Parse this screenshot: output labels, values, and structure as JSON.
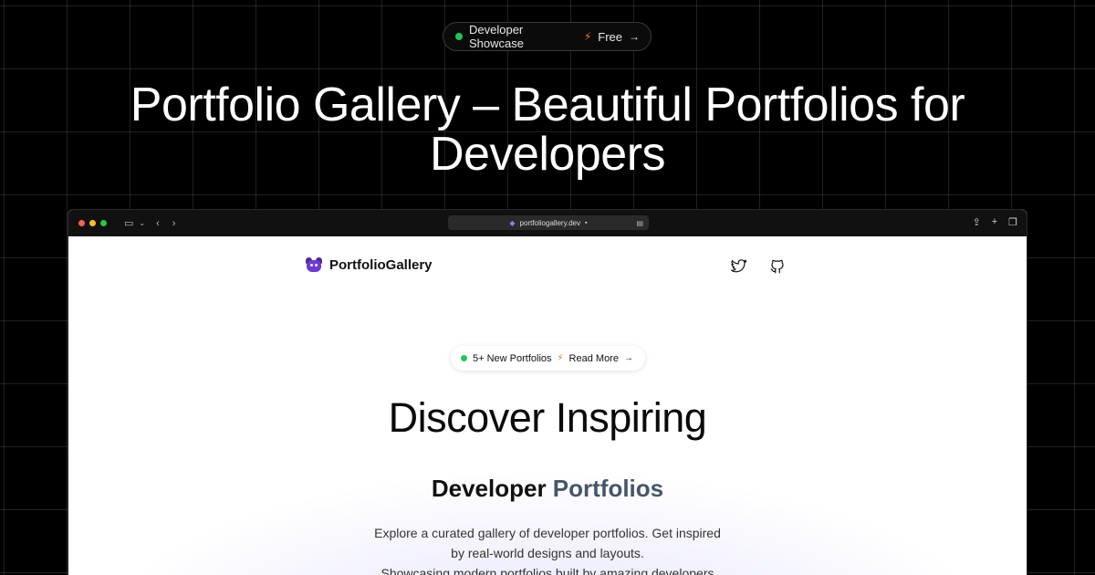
{
  "top_badge": {
    "label": "Developer Showcase",
    "bolt_icon": "⚡",
    "cta": "Free",
    "arrow": "→",
    "dot_color": "#22c55e"
  },
  "hero": {
    "title_line1": "Portfolio Gallery – Beautiful Portfolios for",
    "title_line2": "Developers"
  },
  "browser": {
    "url": "portfoliogallery.dev",
    "lock_icon": "🔒"
  },
  "site": {
    "logo_text": "PortfolioGallery",
    "nav_icons": [
      "twitter-icon",
      "github-icon"
    ],
    "badge": {
      "label": "5+ New Portfolios",
      "cta": "Read More",
      "arrow": "→"
    },
    "headline": "Discover Inspiring",
    "subheadline_part1": "Developer ",
    "subheadline_part2": "Portfolios",
    "description": [
      "Explore a curated gallery of developer portfolios. Get inspired",
      "by real-world designs and layouts.",
      "Showcasing modern portfolios built by amazing developers"
    ]
  }
}
